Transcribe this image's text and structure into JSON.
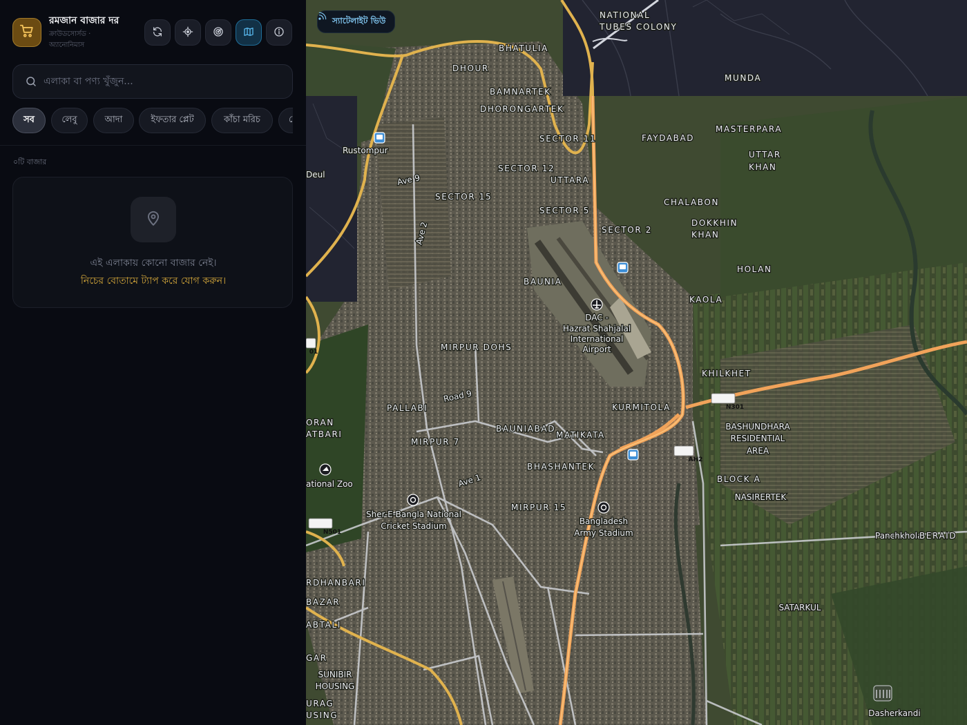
{
  "app": {
    "title": "রমজান বাজার দর",
    "subtitle": "ক্রাউডসোর্সড · অ্যানোনিমাস",
    "logo_icon": "shopping-cart-icon"
  },
  "toolbar": {
    "buttons": [
      {
        "icon": "refresh-icon"
      },
      {
        "icon": "locate-icon"
      },
      {
        "icon": "radar-icon"
      },
      {
        "icon": "map-icon",
        "active": true
      },
      {
        "icon": "info-icon"
      }
    ]
  },
  "search": {
    "value": "",
    "placeholder": "এলাকা বা পণ্য খুঁজুন..."
  },
  "filters": {
    "chips": [
      "সব",
      "লেবু",
      "আদা",
      "ইফতার প্লেট",
      "কাঁচা মরিচ",
      "ে"
    ],
    "selected": "সব"
  },
  "markets": {
    "count_label": "০টি বাজার",
    "empty_line1": "এই এলাকায় কোনো বাজার নেই।",
    "empty_line2": "নিচের বোতামে ট্যাপ করে যোগ করুন।"
  },
  "map": {
    "view_toggle_label": "স্যাটেলাইট ভিউ",
    "view_toggle_icon": "satellite-icon",
    "labels": [
      "NATIONAL",
      "TUBES COLONY",
      "MUNDA",
      "BHATULIA",
      "DHOUR",
      "BAMNARTEK",
      "DHORONGARTEK",
      "SECTOR 11",
      "FAYDABAD",
      "MASTERPARA",
      "Rustompur",
      "UTTAR",
      "KHAN",
      "Deul",
      "SECTOR 12",
      "Ave 9",
      "UTTARA",
      "SECTOR 15",
      "CHALABON",
      "SECTOR 5",
      "DOKKHIN",
      "KHAN",
      "SECTOR 2",
      "Ave 2",
      "HOLAN",
      "BAUNIA",
      "KAOLA",
      "DAC -",
      "Hazrat Shahjalal",
      "International",
      "Airport",
      "MIRPUR DOHS",
      "KHILKHET",
      "Road 9",
      "PALLABI",
      "KURMITOLA",
      "N301",
      "ORAN",
      "ATBARI",
      "BASHUNDHARA",
      "RESIDENTIAL",
      "AREA",
      "MIRPUR 7",
      "BAUNIABAD",
      "MATIKATA",
      "AH2",
      "BHASHANTEK",
      "BLOCK A",
      "ational Zoo",
      "Ave 1",
      "NASIRERTEK",
      "MIRPUR 15",
      "Sher-E-Bangla National",
      "Cricket Stadium",
      "Bangladesh",
      "Army Stadium",
      "N501",
      "Panchkhola",
      "BERAID",
      "RDHANBARI",
      "BAZAR",
      "SATARKUL",
      "ABTALI",
      "GAR",
      "SUNIBIR",
      "HOUSING",
      "URAG",
      "USING",
      "Dasherkandi",
      "01"
    ]
  },
  "colors": {
    "accent": "#d4a73a",
    "sidebar_bg": "#090b12",
    "active_button": "#123146",
    "road_primary": "#e0b24e",
    "road_highway": "#f1a35a"
  }
}
